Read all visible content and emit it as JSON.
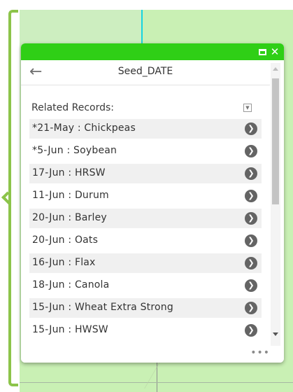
{
  "popup": {
    "title": "Seed_DATE",
    "back_icon": "arrow-left-icon",
    "window_controls": {
      "maximize_icon": "maximize-icon",
      "close_icon": "close-icon",
      "close_glyph": "✕"
    },
    "related_records_label": "Related Records:",
    "records": [
      {
        "label": "*21-May : Chickpeas"
      },
      {
        "label": "*5-Jun : Soybean"
      },
      {
        "label": "17-Jun : HRSW"
      },
      {
        "label": "11-Jun : Durum"
      },
      {
        "label": "20-Jun : Barley"
      },
      {
        "label": "20-Jun : Oats"
      },
      {
        "label": "16-Jun : Flax"
      },
      {
        "label": "18-Jun : Canola"
      },
      {
        "label": "15-Jun : Wheat Extra Strong"
      },
      {
        "label": "15-Jun : HWSW"
      }
    ],
    "more_glyph": "•••",
    "colors": {
      "titlebar": "#2fcf16",
      "bracket": "#8cc44a",
      "map_fill": "#c9f0b4",
      "arrow_badge": "#646464"
    }
  }
}
